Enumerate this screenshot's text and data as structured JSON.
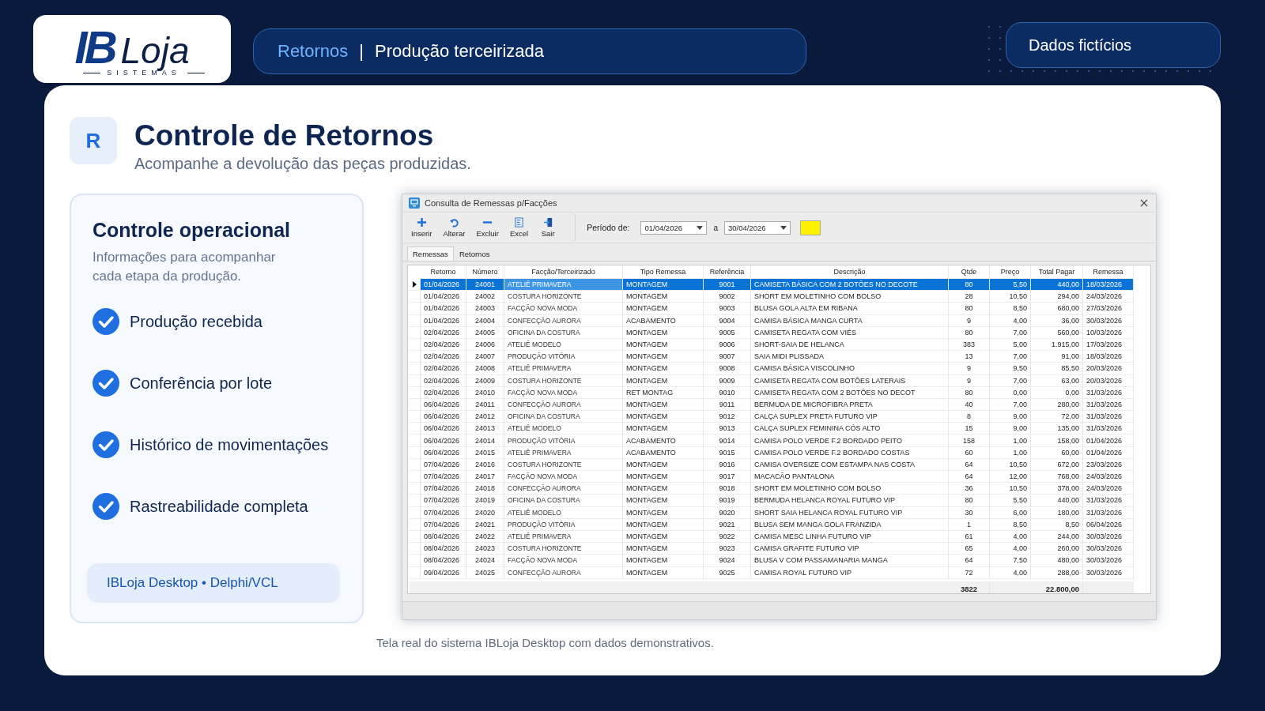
{
  "logo": {
    "mark": "IB",
    "word": "Loja",
    "tagline": "SISTEMAS"
  },
  "breadcrumb": {
    "section": "Retornos",
    "separator": "|",
    "page": "Produção terceirizada"
  },
  "badge": "Dados fictícios",
  "header": {
    "initial": "R",
    "title": "Controle de Retornos",
    "subtitle": "Acompanhe a devolução das peças produzidas."
  },
  "side_panel": {
    "title": "Controle operacional",
    "description": "Informações para acompanhar cada etapa da produção.",
    "features": [
      "Produção recebida",
      "Conferência por lote",
      "Histórico de movimentações",
      "Rastreabilidade completa"
    ],
    "tag": "IBLoja Desktop • Delphi/VCL"
  },
  "window": {
    "title": "Consulta de Remessas p/Facções",
    "toolbar": [
      {
        "label": "Inserir",
        "kind": "add"
      },
      {
        "label": "Alterar",
        "kind": "edit"
      },
      {
        "label": "Excluir",
        "kind": "delete"
      },
      {
        "label": "Excel",
        "kind": "excel"
      },
      {
        "label": "Sair",
        "kind": "exit"
      }
    ],
    "period": {
      "label": "Período de:",
      "from": "01/04/2026",
      "joiner": "a",
      "to": "30/04/2026"
    },
    "tabs": [
      {
        "label": "Remessas",
        "selected": true
      },
      {
        "label": "Retornos",
        "selected": false
      }
    ],
    "table": {
      "columns": [
        "Retorno",
        "Número",
        "Facção/Terceirizado",
        "Tipo Remessa",
        "Referência",
        "Descrição",
        "Qtde",
        "Preço",
        "Total Pagar",
        "Remessa"
      ],
      "rows": [
        {
          "selected": true,
          "cells": [
            "01/04/2026",
            "24001",
            "ATELIÊ PRIMAVERA",
            "MONTAGEM",
            "9001",
            "CAMISETA BÁSICA COM 2 BOTÕES NO DECOTE",
            "80",
            "5,50",
            "440,00",
            "18/03/2026"
          ]
        },
        {
          "selected": false,
          "cells": [
            "01/04/2026",
            "24002",
            "COSTURA HORIZONTE",
            "MONTAGEM",
            "9002",
            "SHORT EM MOLETINHO COM BOLSO",
            "28",
            "10,50",
            "294,00",
            "24/03/2026"
          ]
        },
        {
          "selected": false,
          "cells": [
            "01/04/2026",
            "24003",
            "FACÇÃO NOVA MODA",
            "MONTAGEM",
            "9003",
            "BLUSA GOLA ALTA EM RIBANA",
            "80",
            "8,50",
            "680,00",
            "27/03/2026"
          ]
        },
        {
          "selected": false,
          "cells": [
            "01/04/2026",
            "24004",
            "CONFECÇÃO AURORA",
            "ACABAMENTO",
            "9004",
            "CAMISA BÁSICA MANGA CURTA",
            "9",
            "4,00",
            "36,00",
            "30/03/2026"
          ]
        },
        {
          "selected": false,
          "cells": [
            "02/04/2026",
            "24005",
            "OFICINA DA COSTURA",
            "MONTAGEM",
            "9005",
            "CAMISETA REGATA COM VIÉS",
            "80",
            "7,00",
            "560,00",
            "10/03/2026"
          ]
        },
        {
          "selected": false,
          "cells": [
            "02/04/2026",
            "24006",
            "ATELIÊ MODELO",
            "MONTAGEM",
            "9006",
            "SHORT-SAIA DE HELANCA",
            "383",
            "5,00",
            "1.915,00",
            "17/03/2026"
          ]
        },
        {
          "selected": false,
          "cells": [
            "02/04/2026",
            "24007",
            "PRODUÇÃO VITÓRIA",
            "MONTAGEM",
            "9007",
            "SAIA MIDI PLISSADA",
            "13",
            "7,00",
            "91,00",
            "18/03/2026"
          ]
        },
        {
          "selected": false,
          "cells": [
            "02/04/2026",
            "24008",
            "ATELIÊ PRIMAVERA",
            "MONTAGEM",
            "9008",
            "CAMISA BÁSICA VISCOLINHO",
            "9",
            "9,50",
            "85,50",
            "20/03/2026"
          ]
        },
        {
          "selected": false,
          "cells": [
            "02/04/2026",
            "24009",
            "COSTURA HORIZONTE",
            "MONTAGEM",
            "9009",
            "CAMISETA REGATA COM BOTÕES LATERAIS",
            "9",
            "7,00",
            "63,00",
            "20/03/2026"
          ]
        },
        {
          "selected": false,
          "cells": [
            "02/04/2026",
            "24010",
            "FACÇÃO NOVA MODA",
            "RET MONTAG",
            "9010",
            "CAMISETA REGATA COM 2 BOTÕES NO DECOT",
            "80",
            "0,00",
            "0,00",
            "31/03/2026"
          ]
        },
        {
          "selected": false,
          "cells": [
            "06/04/2026",
            "24011",
            "CONFECÇÃO AURORA",
            "MONTAGEM",
            "9011",
            "BERMUDA DE MICROFIBRA PRETA",
            "40",
            "7,00",
            "280,00",
            "31/03/2026"
          ]
        },
        {
          "selected": false,
          "cells": [
            "06/04/2026",
            "24012",
            "OFICINA DA COSTURA",
            "MONTAGEM",
            "9012",
            "CALÇA SUPLEX PRETA FUTURO VIP",
            "8",
            "9,00",
            "72,00",
            "31/03/2026"
          ]
        },
        {
          "selected": false,
          "cells": [
            "06/04/2026",
            "24013",
            "ATELIÊ MODELO",
            "MONTAGEM",
            "9013",
            "CALÇA SUPLEX FEMININA CÓS ALTO",
            "15",
            "9,00",
            "135,00",
            "31/03/2026"
          ]
        },
        {
          "selected": false,
          "cells": [
            "06/04/2026",
            "24014",
            "PRODUÇÃO VITÓRIA",
            "ACABAMENTO",
            "9014",
            "CAMISA POLO VERDE F.2 BORDADO PEITO",
            "158",
            "1,00",
            "158,00",
            "01/04/2026"
          ]
        },
        {
          "selected": false,
          "cells": [
            "06/04/2026",
            "24015",
            "ATELIÊ PRIMAVERA",
            "ACABAMENTO",
            "9015",
            "CAMISA POLO VERDE F.2 BORDADO COSTAS",
            "60",
            "1,00",
            "60,00",
            "01/04/2026"
          ]
        },
        {
          "selected": false,
          "cells": [
            "07/04/2026",
            "24016",
            "COSTURA HORIZONTE",
            "MONTAGEM",
            "9016",
            "CAMISA OVERSIZE COM ESTAMPA NAS COSTA",
            "64",
            "10,50",
            "672,00",
            "23/03/2026"
          ]
        },
        {
          "selected": false,
          "cells": [
            "07/04/2026",
            "24017",
            "FACÇÃO NOVA MODA",
            "MONTAGEM",
            "9017",
            "MACACÃO PANTALONA",
            "64",
            "12,00",
            "768,00",
            "24/03/2026"
          ]
        },
        {
          "selected": false,
          "cells": [
            "07/04/2026",
            "24018",
            "CONFECÇÃO AURORA",
            "MONTAGEM",
            "9018",
            "SHORT EM MOLETINHO COM BOLSO",
            "36",
            "10,50",
            "378,00",
            "24/03/2026"
          ]
        },
        {
          "selected": false,
          "cells": [
            "07/04/2026",
            "24019",
            "OFICINA DA COSTURA",
            "MONTAGEM",
            "9019",
            "BERMUDA HELANCA ROYAL FUTURO VIP",
            "80",
            "5,50",
            "440,00",
            "31/03/2026"
          ]
        },
        {
          "selected": false,
          "cells": [
            "07/04/2026",
            "24020",
            "ATELIÊ MODELO",
            "MONTAGEM",
            "9020",
            "SHORT SAIA HELANCA ROYAL FUTURO VIP",
            "30",
            "6,00",
            "180,00",
            "31/03/2026"
          ]
        },
        {
          "selected": false,
          "cells": [
            "07/04/2026",
            "24021",
            "PRODUÇÃO VITÓRIA",
            "MONTAGEM",
            "9021",
            "BLUSA SEM MANGA GOLA FRANZIDA",
            "1",
            "8,50",
            "8,50",
            "06/04/2026"
          ]
        },
        {
          "selected": false,
          "cells": [
            "08/04/2026",
            "24022",
            "ATELIÊ PRIMAVERA",
            "MONTAGEM",
            "9022",
            "CAMISA MESC LINHA FUTURO VIP",
            "61",
            "4,00",
            "244,00",
            "30/03/2026"
          ]
        },
        {
          "selected": false,
          "cells": [
            "08/04/2026",
            "24023",
            "COSTURA HORIZONTE",
            "MONTAGEM",
            "9023",
            "CAMISA GRAFITE FUTURO VIP",
            "65",
            "4,00",
            "260,00",
            "30/03/2026"
          ]
        },
        {
          "selected": false,
          "cells": [
            "08/04/2026",
            "24024",
            "FACÇÃO NOVA MODA",
            "MONTAGEM",
            "9024",
            "BLUSA V COM PASSAMANARIA MANGA",
            "64",
            "7,50",
            "480,00",
            "30/03/2026"
          ]
        },
        {
          "selected": false,
          "cells": [
            "09/04/2026",
            "24025",
            "CONFECÇÃO AURORA",
            "MONTAGEM",
            "9025",
            "CAMISA ROYAL FUTURO VIP",
            "72",
            "4,00",
            "288,00",
            "30/03/2026"
          ]
        }
      ],
      "totals": {
        "quantity": "3822",
        "amount": "22.800,00"
      }
    }
  },
  "caption": "Tela real do sistema IBLoja Desktop com dados demonstrativos."
}
